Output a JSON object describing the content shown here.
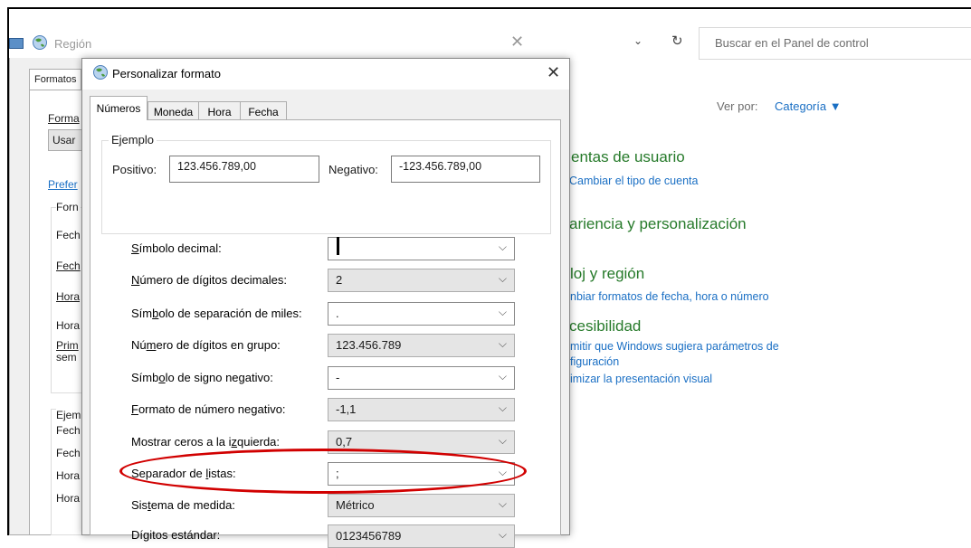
{
  "control_panel": {
    "search_placeholder": "Buscar en el Panel de control",
    "view_by_label": "Ver por:",
    "view_by_value": "Categoría ▼",
    "dropdown_glyph": "⌄",
    "refresh_glyph": "↻",
    "sections": [
      {
        "heading": "entas de usuario",
        "links": [
          "Cambiar el tipo de cuenta"
        ]
      },
      {
        "heading": "ariencia y personalización",
        "links": []
      },
      {
        "heading": "loj y región",
        "links": [
          "nbiar formatos de fecha, hora o número"
        ]
      },
      {
        "heading": "cesibilidad",
        "links": [
          "mitir que Windows sugiera parámetros de",
          "figuración",
          "imizar la presentación visual"
        ]
      }
    ],
    "link_color": "#1a6fc4",
    "heading_color": "#267a2a"
  },
  "region_window": {
    "title": "Región",
    "close_glyph": "✕",
    "tab_label": "Formatos",
    "format_label": "Forma",
    "use_label": "Usar",
    "prefs_link": "Prefer",
    "rows": [
      "Forn",
      "Fech",
      "Fech",
      "Hora",
      "Hora",
      "Prim",
      "sem"
    ],
    "example_rows": [
      "Ejem",
      "Fech",
      "Fech",
      "Hora",
      "Hora"
    ]
  },
  "dialog": {
    "title": "Personalizar formato",
    "close_glyph": "✕",
    "tabs": [
      "Números",
      "Moneda",
      "Hora",
      "Fecha"
    ],
    "active_tab": "Números",
    "example": {
      "group_label": "Ejemplo",
      "positive_label": "Positivo:",
      "positive_value": "123.456.789,00",
      "negative_label": "Negativo:",
      "negative_value": "-123.456.789,00"
    },
    "settings": [
      {
        "label": "Símbolo decimal:",
        "value": "",
        "style": "white"
      },
      {
        "label": "Número de dígitos decimales:",
        "value": "2",
        "style": "grey"
      },
      {
        "label": "Símbolo de separación de miles:",
        "value": ".",
        "style": "white"
      },
      {
        "label": "Número de dígitos en grupo:",
        "value": "123.456.789",
        "style": "grey"
      },
      {
        "label": "Símbolo de signo negativo:",
        "value": "-",
        "style": "white"
      },
      {
        "label": "Formato de número negativo:",
        "value": "-1,1",
        "style": "grey"
      },
      {
        "label": "Mostrar ceros a la izquierda:",
        "value": "0,7",
        "style": "grey"
      },
      {
        "label": "Separador de listas:",
        "value": ";",
        "style": "white"
      },
      {
        "label": "Sistema de medida:",
        "value": "Métrico",
        "style": "grey"
      },
      {
        "label": "Dígitos estándar:",
        "value": "0123456789",
        "style": "grey"
      }
    ],
    "chevron_glyph": "⌵",
    "highlight_color": "#d10000"
  }
}
